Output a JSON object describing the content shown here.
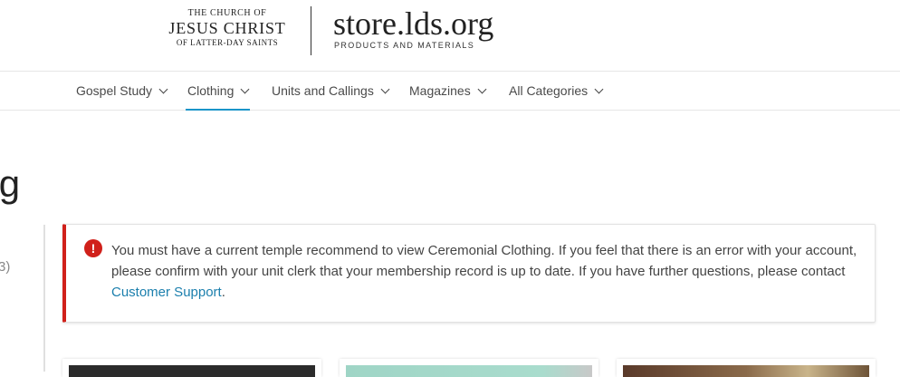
{
  "header": {
    "church_logo": {
      "line1": "The Church of",
      "line2": "Jesus Christ",
      "line3": "of Latter-day Saints"
    },
    "store_title": "store.lds.org",
    "store_subtitle": "Products and Materials"
  },
  "nav": {
    "items": [
      {
        "label": "Gospel Study",
        "active": false
      },
      {
        "label": "Clothing",
        "active": true
      },
      {
        "label": "Units and Callings",
        "active": false
      },
      {
        "label": "Magazines",
        "active": false
      },
      {
        "label": "All Categories",
        "active": false
      }
    ]
  },
  "page": {
    "title_partial": "ing",
    "side_count_partial": "3)"
  },
  "alert": {
    "icon": "error-icon",
    "icon_glyph": "!",
    "message_before_link": "You must have a current temple recommend to view Ceremonial Clothing. If you feel that there is an error with your account, please confirm with your unit clerk that your membership record is up to date. If you have further questions, please contact ",
    "link_text": "Customer Support",
    "message_after_link": ".",
    "accent_color": "#d0201a"
  },
  "colors": {
    "nav_active_underline": "#1b95c9",
    "link": "#1b7fad"
  },
  "product_cards": [
    {
      "image": "product-image-dark"
    },
    {
      "image": "product-image-mint"
    },
    {
      "image": "product-image-brown"
    }
  ]
}
